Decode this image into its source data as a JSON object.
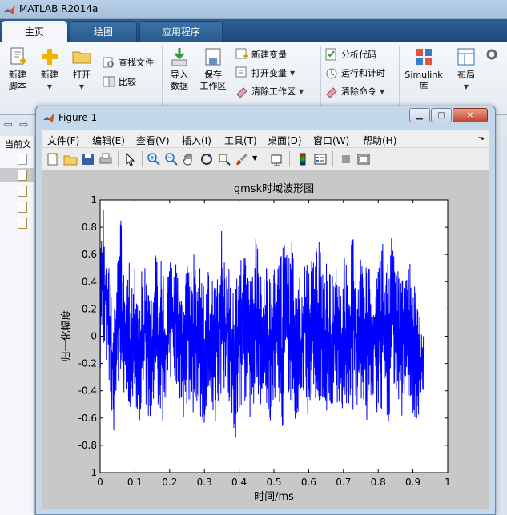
{
  "app": {
    "title": "MATLAB R2014a"
  },
  "tabs": [
    {
      "label": "主页",
      "active": true
    },
    {
      "label": "绘图",
      "active": false
    },
    {
      "label": "应用程序",
      "active": false
    }
  ],
  "ribbon": {
    "new_script": "新建\n脚本",
    "new": "新建",
    "open": "打开",
    "find_files": "查找文件",
    "compare": "比较",
    "import_data": "导入\n数据",
    "save_workspace": "保存\n工作区",
    "new_variable": "新建变量",
    "open_variable": "打开变量",
    "clear_workspace": "清除工作区",
    "analyze_code": "分析代码",
    "run_and_time": "运行和计时",
    "clear_commands": "清除命令",
    "simulink": "Simulink\n库",
    "layout": "布局"
  },
  "left_panel": {
    "current_folder_label": "当前文"
  },
  "figure": {
    "title": "Figure 1",
    "menus": [
      "文件(F)",
      "编辑(E)",
      "查看(V)",
      "插入(I)",
      "工具(T)",
      "桌面(D)",
      "窗口(W)",
      "帮助(H)"
    ]
  },
  "chart_data": {
    "type": "line",
    "title": "gmsk时域波形图",
    "xlabel": "时间/ms",
    "ylabel": "归一化幅度",
    "xlim": [
      0,
      1
    ],
    "ylim": [
      -1,
      1
    ],
    "xticks": [
      "0",
      "0.1",
      "0.2",
      "0.3",
      "0.4",
      "0.5",
      "0.6",
      "0.7",
      "0.8",
      "0.9",
      "1"
    ],
    "yticks": [
      "1",
      "0.8",
      "0.6",
      "0.4",
      "0.2",
      "0",
      "-0.2",
      "-0.4",
      "-0.6",
      "-0.8",
      "-1"
    ],
    "grid": false,
    "series": [
      {
        "color": "#0000ff",
        "x_range": [
          0,
          0.93
        ],
        "amplitude_envelope": [
          [
            0.0,
            0.7,
            -0.4
          ],
          [
            0.01,
            1.0,
            -0.05
          ],
          [
            0.02,
            0.62,
            -0.28
          ],
          [
            0.03,
            0.55,
            -0.55
          ],
          [
            0.04,
            0.3,
            -0.72
          ],
          [
            0.05,
            0.52,
            -0.4
          ],
          [
            0.06,
            0.88,
            -0.3
          ],
          [
            0.07,
            0.4,
            -0.45
          ],
          [
            0.08,
            0.72,
            -0.48
          ],
          [
            0.09,
            0.32,
            -0.6
          ],
          [
            0.1,
            0.58,
            -0.52
          ],
          [
            0.11,
            0.4,
            -0.62
          ],
          [
            0.12,
            0.52,
            -0.7
          ],
          [
            0.13,
            0.6,
            -0.48
          ],
          [
            0.14,
            0.4,
            -0.62
          ],
          [
            0.15,
            0.3,
            -0.55
          ],
          [
            0.16,
            0.62,
            -0.48
          ],
          [
            0.17,
            0.42,
            -0.52
          ],
          [
            0.18,
            0.68,
            -0.7
          ],
          [
            0.19,
            0.3,
            -0.48
          ],
          [
            0.2,
            0.58,
            -0.36
          ],
          [
            0.21,
            0.48,
            -0.48
          ],
          [
            0.22,
            0.7,
            -0.55
          ],
          [
            0.23,
            0.32,
            -0.48
          ],
          [
            0.24,
            0.38,
            -0.76
          ],
          [
            0.25,
            0.58,
            -0.48
          ],
          [
            0.26,
            0.46,
            -0.52
          ],
          [
            0.27,
            0.7,
            -0.62
          ],
          [
            0.28,
            0.36,
            -0.48
          ],
          [
            0.29,
            0.58,
            -0.62
          ],
          [
            0.3,
            0.32,
            -0.72
          ],
          [
            0.31,
            0.48,
            -0.55
          ],
          [
            0.32,
            0.5,
            -0.48
          ],
          [
            0.33,
            0.4,
            -0.7
          ],
          [
            0.34,
            0.58,
            -0.55
          ],
          [
            0.35,
            0.82,
            -0.48
          ],
          [
            0.36,
            0.48,
            -0.42
          ],
          [
            0.37,
            0.62,
            -0.52
          ],
          [
            0.38,
            0.32,
            -0.62
          ],
          [
            0.39,
            0.4,
            -0.8
          ],
          [
            0.4,
            0.52,
            -0.55
          ],
          [
            0.41,
            0.72,
            -0.48
          ],
          [
            0.42,
            0.52,
            -0.52
          ],
          [
            0.43,
            0.38,
            -0.62
          ],
          [
            0.44,
            0.62,
            -0.72
          ],
          [
            0.45,
            0.9,
            -0.55
          ],
          [
            0.46,
            0.52,
            -0.48
          ],
          [
            0.47,
            0.48,
            -0.7
          ],
          [
            0.48,
            0.58,
            -0.55
          ],
          [
            0.49,
            0.4,
            -0.62
          ],
          [
            0.5,
            0.66,
            -0.48
          ],
          [
            0.51,
            0.52,
            -0.58
          ],
          [
            0.52,
            0.6,
            -0.85
          ],
          [
            0.53,
            0.88,
            -0.52
          ],
          [
            0.54,
            0.52,
            -0.55
          ],
          [
            0.55,
            0.78,
            -0.52
          ],
          [
            0.56,
            0.48,
            -0.62
          ],
          [
            0.57,
            0.58,
            -0.72
          ],
          [
            0.58,
            0.4,
            -0.55
          ],
          [
            0.59,
            0.62,
            -0.48
          ],
          [
            0.6,
            0.48,
            -0.68
          ],
          [
            0.61,
            0.6,
            -0.52
          ],
          [
            0.62,
            0.7,
            -0.62
          ],
          [
            0.63,
            0.78,
            -0.48
          ],
          [
            0.64,
            0.52,
            -0.55
          ],
          [
            0.65,
            0.58,
            -0.62
          ],
          [
            0.66,
            0.48,
            -0.52
          ],
          [
            0.67,
            0.62,
            -0.65
          ],
          [
            0.68,
            0.5,
            -0.48
          ],
          [
            0.69,
            0.4,
            -0.55
          ],
          [
            0.7,
            0.68,
            -0.62
          ],
          [
            0.71,
            0.52,
            -0.48
          ],
          [
            0.72,
            0.62,
            -0.52
          ],
          [
            0.73,
            0.88,
            -0.62
          ],
          [
            0.74,
            0.4,
            -0.58
          ],
          [
            0.75,
            0.58,
            -0.48
          ],
          [
            0.76,
            0.48,
            -0.55
          ],
          [
            0.77,
            0.62,
            -0.65
          ],
          [
            0.78,
            0.36,
            -0.52
          ],
          [
            0.79,
            0.48,
            -0.48
          ],
          [
            0.8,
            0.62,
            -0.62
          ],
          [
            0.81,
            0.8,
            -0.55
          ],
          [
            0.82,
            0.48,
            -0.52
          ],
          [
            0.83,
            0.58,
            -0.68
          ],
          [
            0.84,
            0.82,
            -0.48
          ],
          [
            0.85,
            0.52,
            -0.58
          ],
          [
            0.86,
            0.62,
            -0.45
          ],
          [
            0.87,
            0.4,
            -0.62
          ],
          [
            0.88,
            0.5,
            -0.45
          ],
          [
            0.89,
            0.58,
            -0.78
          ],
          [
            0.9,
            0.52,
            -0.7
          ],
          [
            0.91,
            0.3,
            -0.62
          ],
          [
            0.92,
            0.15,
            -0.55
          ],
          [
            0.93,
            0.0,
            -0.4
          ]
        ]
      }
    ]
  }
}
